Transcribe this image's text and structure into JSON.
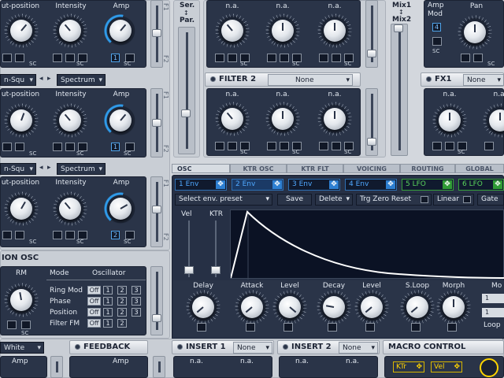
{
  "osc_rows": [
    {
      "labels": [
        "ut-position",
        "Intensity",
        "Amp"
      ],
      "mode": "",
      "spectrum": "",
      "amp_value": "1"
    },
    {
      "labels": [
        "ut-position",
        "Intensity",
        "Amp"
      ],
      "mode": "n-Squ",
      "spectrum": "Spectrum",
      "amp_value": "1"
    },
    {
      "labels": [
        "ut-position",
        "Intensity",
        "Amp"
      ],
      "mode": "n-Squ",
      "spectrum": "Spectrum",
      "amp_value": "2"
    }
  ],
  "sc_label": "SC",
  "f1": "F1",
  "f2": "F2",
  "ser_par": {
    "top": "Ser.",
    "mid": "↕",
    "bottom": "Par."
  },
  "filter1": {
    "knob_labels": [
      "n.a.",
      "n.a.",
      "n.a."
    ]
  },
  "filter2": {
    "title": "FILTER 2",
    "type": "None",
    "knob_labels": [
      "n.a.",
      "n.a.",
      "n.a."
    ]
  },
  "mix": {
    "top": "Mix1",
    "mid": "↕",
    "bottom": "Mix2"
  },
  "amp_mod": {
    "label1": "Amp",
    "label2": "Mod",
    "pan": "Pan",
    "value": "4"
  },
  "fx1": {
    "title": "FX1",
    "type": "None",
    "knob_labels": [
      "n.a.",
      "n.a."
    ]
  },
  "tabs": [
    "OSC",
    "KTR OSC",
    "KTR FLT",
    "VOICING",
    "ROUTING",
    "GLOBAL"
  ],
  "env_buttons": [
    {
      "label": "1 Env",
      "color": "#4fa8ff"
    },
    {
      "label": "2 Env",
      "color": "#4fa8ff"
    },
    {
      "label": "3 Env",
      "color": "#4fa8ff"
    },
    {
      "label": "4 Env",
      "color": "#4fa8ff"
    },
    {
      "label": "5 LFO",
      "color": "#59d35c"
    },
    {
      "label": "6 LFO",
      "color": "#59d35c"
    }
  ],
  "env_toolbar": {
    "preset": "Select env. preset",
    "save": "Save",
    "delete": "Delete",
    "trg_zero_reset": "Trg Zero Reset",
    "linear": "Linear",
    "gate": "Gate"
  },
  "env_sliders": {
    "vel": "Vel",
    "ktr": "KTR"
  },
  "env_knobs": [
    "Delay",
    "Attack",
    "Level",
    "Decay",
    "Level",
    "S.Loop",
    "Morph"
  ],
  "env_right": {
    "mo": "Mo",
    "v1": "1",
    "v2": "1",
    "loop": "Loop"
  },
  "ring_osc": {
    "title": "ION OSC",
    "rm": "RM",
    "headers": [
      "Mode",
      "Oscillator"
    ],
    "rows": [
      {
        "label": "Ring Mod",
        "state": "Off",
        "nums": [
          "1",
          "2",
          "3"
        ]
      },
      {
        "label": "Phase",
        "state": "Off",
        "nums": [
          "1",
          "2",
          "3"
        ]
      },
      {
        "label": "Position",
        "state": "Off",
        "nums": [
          "1",
          "2",
          "3"
        ]
      },
      {
        "label": "Filter FM",
        "state": "Off",
        "nums": [
          "1",
          "2"
        ]
      }
    ]
  },
  "bottom": {
    "white": "White",
    "amp": "Amp",
    "feedback": "FEEDBACK",
    "feedback_amp": "Amp",
    "insert1": {
      "title": "INSERT 1",
      "type": "None",
      "labels": [
        "n.a.",
        "n.a."
      ]
    },
    "insert2": {
      "title": "INSERT 2",
      "type": "None",
      "labels": [
        "n.a.",
        "n.a."
      ]
    },
    "macro": {
      "title": "MACRO CONTROL",
      "ktr": "KTr",
      "vel": "Vel"
    }
  }
}
